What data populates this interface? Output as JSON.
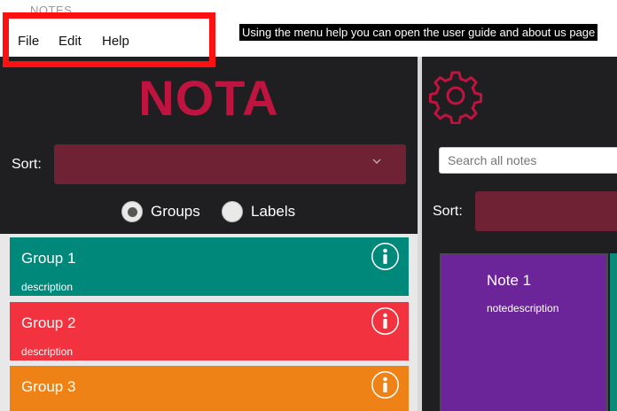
{
  "window": {
    "title": "NOTES"
  },
  "menubar": {
    "file": "File",
    "edit": "Edit",
    "help": "Help"
  },
  "annotation": "Using the menu help you can open the user guide and about us page",
  "left": {
    "logo": "NOTA",
    "sort_label": "Sort:",
    "radios": {
      "groups": "Groups",
      "labels": "Labels",
      "selected": "Groups"
    },
    "groups": [
      {
        "title": "Group 1",
        "description": "description",
        "color": "#00897b"
      },
      {
        "title": "Group 2",
        "description": "description",
        "color": "#f2323e"
      },
      {
        "title": "Group 3",
        "description": "description",
        "color": "#ef8216"
      }
    ]
  },
  "right": {
    "search_placeholder": "Search all notes",
    "sort_label": "Sort:",
    "notes": [
      {
        "title": "Note 1",
        "description": "notedescription",
        "color": "#6b2598"
      }
    ]
  },
  "colors": {
    "accent": "#bf1440",
    "panel_bg": "#1f1e21",
    "select_bg": "#6e2233"
  },
  "icons": {
    "settings": "gear-icon",
    "info": "info-icon",
    "dropdown": "chevron-down-icon"
  }
}
